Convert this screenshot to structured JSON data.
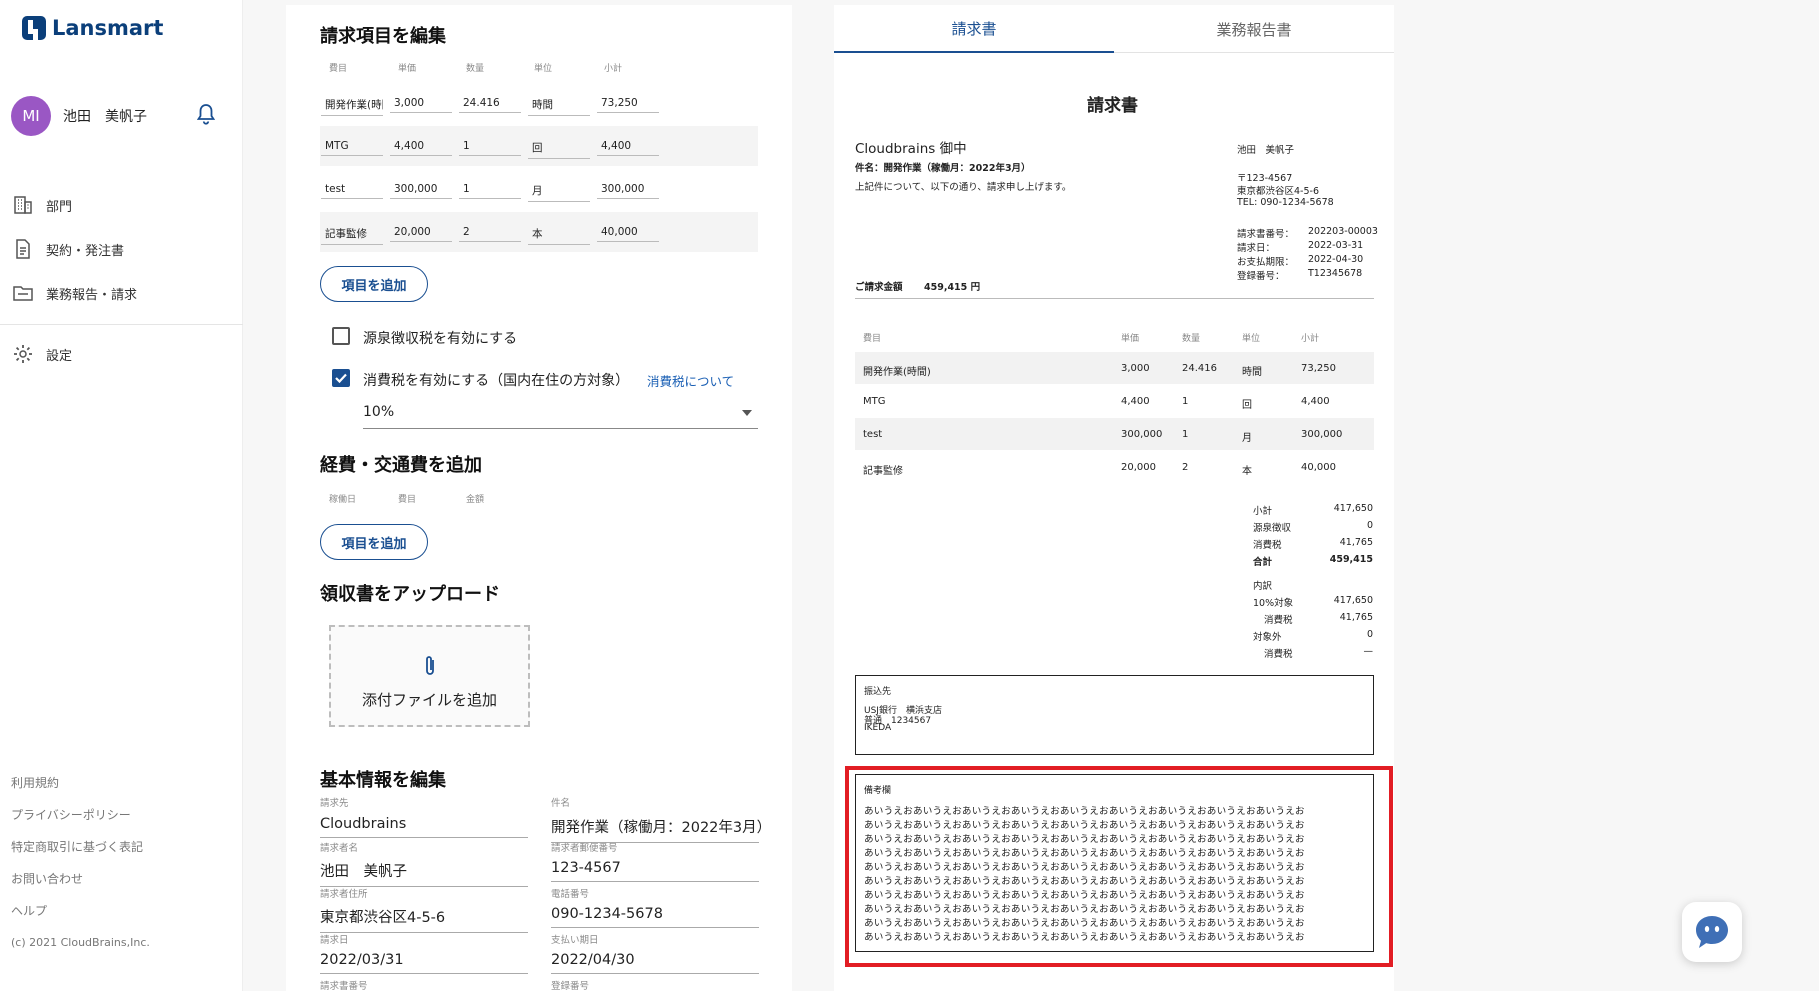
{
  "app": {
    "brand": "Lansmart"
  },
  "user": {
    "initials": "MI",
    "name": "池田　美帆子"
  },
  "sidebar": {
    "items": [
      {
        "label": "部門"
      },
      {
        "label": "契約・発注書"
      },
      {
        "label": "業務報告・請求"
      },
      {
        "label": "設定"
      }
    ],
    "footer": [
      "利用規約",
      "プライバシーポリシー",
      "特定商取引に基づく表記",
      "お問い合わせ",
      "ヘルプ",
      "(c) 2021 CloudBrains,Inc."
    ]
  },
  "editor": {
    "items_title": "請求項目を編集",
    "columns": [
      "費目",
      "単価",
      "数量",
      "単位",
      "小計"
    ],
    "rows": [
      [
        "開発作業(時間",
        "3,000",
        "24.416",
        "時間",
        "73,250"
      ],
      [
        "MTG",
        "4,400",
        "1",
        "回",
        "4,400"
      ],
      [
        "test",
        "300,000",
        "1",
        "月",
        "300,000"
      ],
      [
        "記事監修",
        "20,000",
        "2",
        "本",
        "40,000"
      ]
    ],
    "add_item": "項目を追加",
    "withholding_label": "源泉徴収税を有効にする",
    "tax_label": "消費税を有効にする（国内在住の方対象）",
    "tax_link": "消費税について",
    "tax_rate": "10%",
    "expense_title": "経費・交通費を追加",
    "expense_columns": [
      "稼働日",
      "費目",
      "金額"
    ],
    "add_expense": "項目を追加",
    "receipt_title": "領収書をアップロード",
    "attach_label": "添付ファイルを追加",
    "basic_title": "基本情報を編集",
    "fields": [
      {
        "label": "請求先",
        "value": "Cloudbrains"
      },
      {
        "label": "件名",
        "value": "開発作業（稼働月：2022年3月）"
      },
      {
        "label": "請求者名",
        "value": "池田　美帆子"
      },
      {
        "label": "請求者郵便番号",
        "value": "123-4567"
      },
      {
        "label": "請求者住所",
        "value": "東京都渋谷区4-5-6"
      },
      {
        "label": "電話番号",
        "value": "090-1234-5678"
      },
      {
        "label": "請求日",
        "value": "2022/03/31"
      },
      {
        "label": "支払い期日",
        "value": "2022/04/30"
      },
      {
        "label": "請求書番号",
        "value": ""
      },
      {
        "label": "登録番号",
        "value": ""
      }
    ]
  },
  "preview": {
    "tabs": [
      "請求書",
      "業務報告書"
    ],
    "title": "請求書",
    "client": "Cloudbrains 御中",
    "subject": "件名：開発作業（稼働月：2022年3月）",
    "intro": "上記件について、以下の通り、請求申し上げます。",
    "issuer_name": "池田　美帆子",
    "postal": "〒123-4567",
    "address": "東京都渋谷区4-5-6",
    "tel": "TEL: 090-1234-5678",
    "meta": [
      {
        "k": "請求書番号：",
        "v": "202203-00003"
      },
      {
        "k": "請求日：",
        "v": "2022-03-31"
      },
      {
        "k": "お支払期限：",
        "v": "2022-04-30"
      },
      {
        "k": "登録番号：",
        "v": "T12345678"
      }
    ],
    "total_label": "ご請求金額",
    "total_value": "459,415 円",
    "columns": [
      "費目",
      "単価",
      "数量",
      "単位",
      "小計"
    ],
    "rows": [
      [
        "開発作業(時間)",
        "3,000",
        "24.416",
        "時間",
        "73,250"
      ],
      [
        "MTG",
        "4,400",
        "1",
        "回",
        "4,400"
      ],
      [
        "test",
        "300,000",
        "1",
        "月",
        "300,000"
      ],
      [
        "記事監修",
        "20,000",
        "2",
        "本",
        "40,000"
      ]
    ],
    "summary": [
      {
        "k": "小計",
        "v": "417,650",
        "bold": false,
        "indent": false
      },
      {
        "k": "源泉徴収",
        "v": "0",
        "bold": false,
        "indent": false
      },
      {
        "k": "消費税",
        "v": "41,765",
        "bold": false,
        "indent": false
      },
      {
        "k": "合計",
        "v": "459,415",
        "bold": true,
        "indent": false
      },
      {
        "k": "内訳",
        "v": "",
        "bold": false,
        "indent": false
      },
      {
        "k": "10%対象",
        "v": "417,650",
        "bold": false,
        "indent": false
      },
      {
        "k": "消費税",
        "v": "41,765",
        "bold": false,
        "indent": true
      },
      {
        "k": "対象外",
        "v": "0",
        "bold": false,
        "indent": false
      },
      {
        "k": "消費税",
        "v": "—",
        "bold": false,
        "indent": true
      }
    ],
    "bank_title": "振込先",
    "bank_lines": [
      "USJ銀行　横浜支店",
      "普通　1234567",
      "IKEDA"
    ],
    "memo_title": "備考欄",
    "memo_lines": [
      "あいうえおあいうえおあいうえおあいうえおあいうえおあいうえおあいうえおあいうえおあいうえお",
      "あいうえおあいうえおあいうえおあいうえおあいうえおあいうえおあいうえおあいうえおあいうえお",
      "あいうえおあいうえおあいうえおあいうえおあいうえおあいうえおあいうえおあいうえおあいうえお",
      "あいうえおあいうえおあいうえおあいうえおあいうえおあいうえおあいうえおあいうえおあいうえお",
      "あいうえおあいうえおあいうえおあいうえおあいうえおあいうえおあいうえおあいうえおあいうえお",
      "あいうえおあいうえおあいうえおあいうえおあいうえおあいうえおあいうえおあいうえおあいうえお",
      "あいうえおあいうえおあいうえおあいうえおあいうえおあいうえおあいうえおあいうえおあいうえお",
      "あいうえおあいうえおあいうえおあいうえおあいうえおあいうえおあいうえおあいうえおあいうえお",
      "あいうえおあいうえおあいうえおあいうえおあいうえおあいうえおあいうえおあいうえおあいうえお",
      "あいうえおあいうえおあいうえおあいうえおあいうえおあいうえおあいうえおあいうえおあいうえお"
    ]
  },
  "colors": {
    "brand": "#0b3f7a",
    "accent": "#1a4f91",
    "highlight": "#e21d24",
    "avatar": "#9a57c4"
  }
}
